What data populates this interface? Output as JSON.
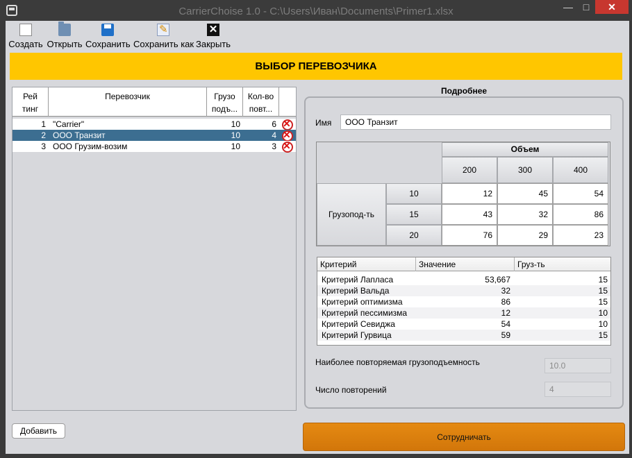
{
  "window": {
    "title": "CarrierChoise 1.0 - C:\\Users\\Иван\\Documents\\Primer1.xlsx",
    "minimize": "—",
    "maximize": "□",
    "close": "✕"
  },
  "toolbar": {
    "create": "Создать",
    "open": "Открыть",
    "save": "Сохранить",
    "save_as": "Сохранить как",
    "close": "Закрыть"
  },
  "banner": "ВЫБОР ПЕРЕВОЗЧИКА",
  "carriers": {
    "headers": {
      "rating_l1": "Рей",
      "rating_l2": "тинг",
      "carrier": "Перевозчик",
      "capacity_l1": "Грузо",
      "capacity_l2": "подъ...",
      "count_l1": "Кол-во",
      "count_l2": "повт..."
    },
    "rows": [
      {
        "rating": "1",
        "name": "\"Carrier\"",
        "capacity": "10",
        "count": "6"
      },
      {
        "rating": "2",
        "name": "ООО Транзит",
        "capacity": "10",
        "count": "4"
      },
      {
        "rating": "3",
        "name": "ООО Грузим-возим",
        "capacity": "10",
        "count": "3"
      }
    ],
    "selected_index": 1
  },
  "add_button": "Добавить",
  "details": {
    "title": "Подробнее",
    "name_label": "Имя",
    "name_value": "ООО Транзит",
    "matrix": {
      "volume_label": "Объем",
      "volumes": [
        "200",
        "300",
        "400"
      ],
      "capacity_label": "Грузопод-ть",
      "capacities": [
        "10",
        "15",
        "20"
      ],
      "values": [
        [
          "12",
          "45",
          "54"
        ],
        [
          "43",
          "32",
          "86"
        ],
        [
          "76",
          "29",
          "23"
        ]
      ]
    },
    "criteria": {
      "headers": {
        "criterion": "Критерий",
        "value": "Значение",
        "capacity": "Груз-ть"
      },
      "rows": [
        {
          "criterion": "Критерий Лапласа",
          "value": "53,667",
          "capacity": "15"
        },
        {
          "criterion": "Критерий Вальда",
          "value": "32",
          "capacity": "15"
        },
        {
          "criterion": "Критерий оптимизма",
          "value": "86",
          "capacity": "15"
        },
        {
          "criterion": "Критерий пессимизма",
          "value": "12",
          "capacity": "10"
        },
        {
          "criterion": "Критерий Севиджа",
          "value": "54",
          "capacity": "10"
        },
        {
          "criterion": "Критерий Гурвица",
          "value": "59",
          "capacity": "15"
        }
      ]
    },
    "most_repeated_label": "Наиболее повторяемая грузоподъемность",
    "most_repeated_value": "10.0",
    "repeat_count_label": "Число повторений",
    "repeat_count_value": "4"
  },
  "cooperate_button": "Сотрудничать"
}
